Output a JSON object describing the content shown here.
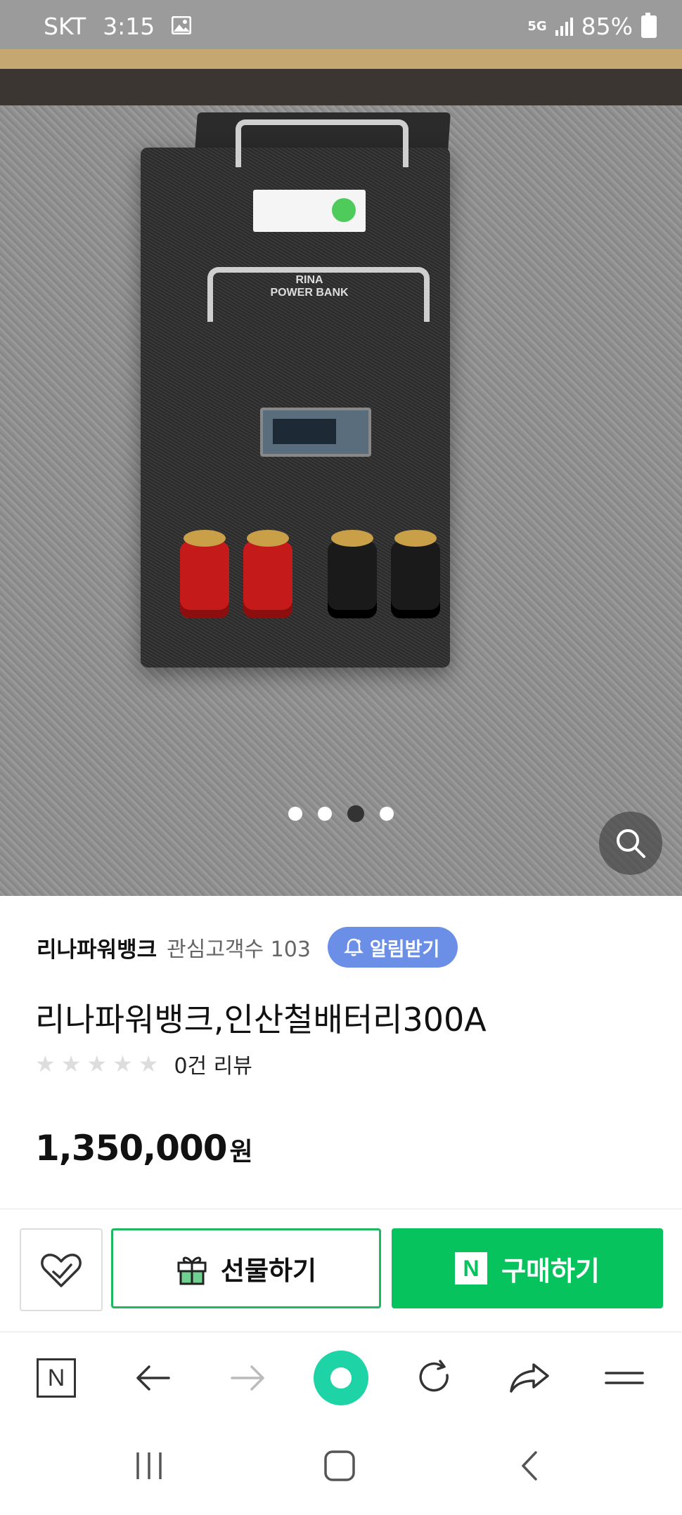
{
  "status_bar": {
    "carrier": "SKT",
    "time": "3:15",
    "network": "5G",
    "battery": "85%"
  },
  "product_photo": {
    "brand_text": "RINA\nPOWER BANK",
    "pages_total": 4,
    "current_page": 3
  },
  "seller": {
    "name": "리나파워뱅크",
    "followers_label": "관심고객수 103",
    "alert_button": "알림받기"
  },
  "product": {
    "title": "리나파워뱅크,인산철배터리300A",
    "rating_stars": 0,
    "review_count": "0건 리뷰",
    "price": "1,350,000",
    "price_unit": "원"
  },
  "actions": {
    "gift_label": "선물하기",
    "buy_label": "구매하기",
    "buy_logo": "N"
  },
  "browser_toolbar": {
    "home_logo": "N"
  },
  "colors": {
    "buy_green": "#06c35d",
    "alert_blue": "#6b8ee6",
    "home_mint": "#1ed3a5"
  }
}
